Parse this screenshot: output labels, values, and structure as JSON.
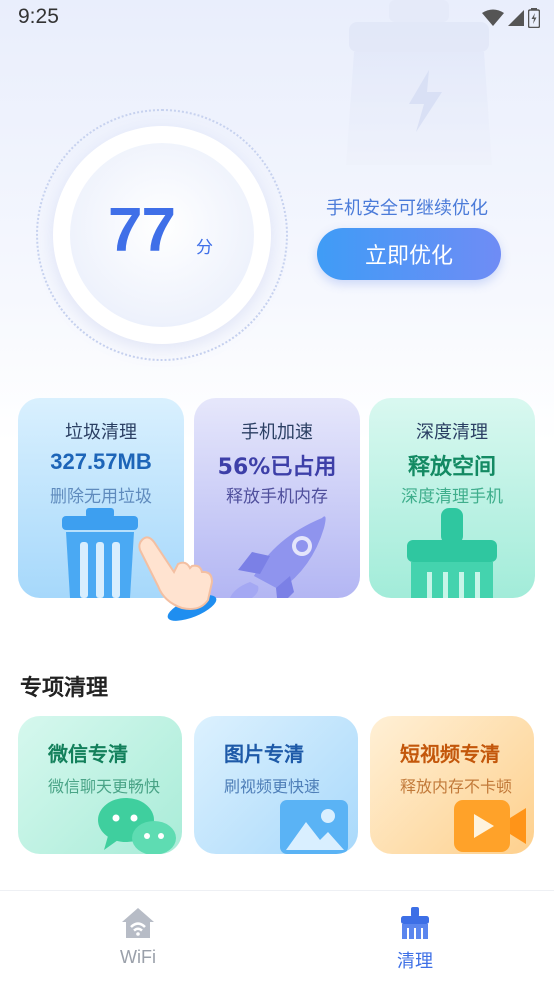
{
  "status_bar": {
    "time": "9:25"
  },
  "score": {
    "value": "77",
    "unit": "分"
  },
  "optimize": {
    "tip": "手机安全可继续优化",
    "button_label": "立即优化"
  },
  "cards": [
    {
      "title": "垃圾清理",
      "value": "327.57MB",
      "sub": "删除无用垃圾",
      "icon": "trash-icon"
    },
    {
      "title": "手机加速",
      "value": "56%已占用",
      "sub": "释放手机内存",
      "icon": "rocket-icon"
    },
    {
      "title": "深度清理",
      "value": "释放空间",
      "sub": "深度清理手机",
      "icon": "broom-icon"
    }
  ],
  "special": {
    "title": "专项清理",
    "items": [
      {
        "title": "微信专清",
        "sub": "微信聊天更畅快",
        "icon": "wechat-icon"
      },
      {
        "title": "图片专清",
        "sub": "刷视频更快速",
        "icon": "image-icon"
      },
      {
        "title": "短视频专清",
        "sub": "释放内存不卡顿",
        "icon": "video-icon"
      }
    ]
  },
  "nav": {
    "items": [
      {
        "label": "WiFi",
        "icon": "home-wifi-icon",
        "active": false
      },
      {
        "label": "清理",
        "icon": "broom-icon",
        "active": true
      }
    ]
  },
  "colors": {
    "accent": "#3f6fe8",
    "button_start": "#3f9cf6",
    "button_end": "#6f8cf5",
    "nav_active": "#3d6fe6",
    "nav_inactive": "#9aa0aa"
  }
}
